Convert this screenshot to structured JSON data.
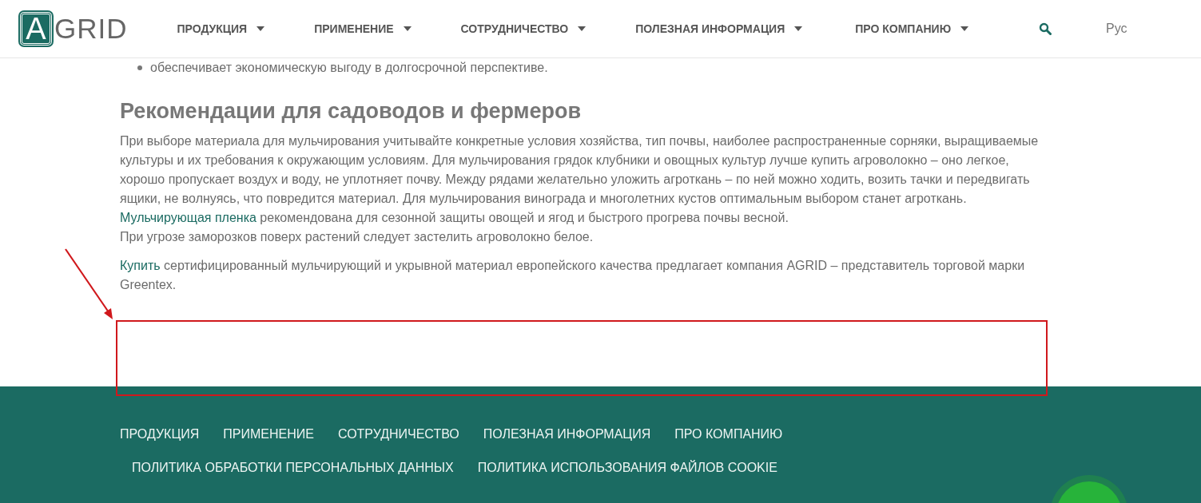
{
  "header": {
    "logo": {
      "letter": "A",
      "text": "GRID"
    },
    "nav": [
      {
        "label": "ПРОДУКЦИЯ",
        "has_dropdown": true
      },
      {
        "label": "ПРИМЕНЕНИЕ",
        "has_dropdown": true
      },
      {
        "label": "СОТРУДНИЧЕСТВО",
        "has_dropdown": true
      },
      {
        "label": "ПОЛЕЗНАЯ ИНФОРМАЦИЯ",
        "has_dropdown": true
      },
      {
        "label": "ПРО КОМПАНИЮ",
        "has_dropdown": true
      }
    ],
    "language": {
      "label": "Рус",
      "selected": true
    }
  },
  "article": {
    "bullets": [
      "обеспечивает экономическую выгоду в долгосрочной перспективе."
    ],
    "heading": "Рекомендации для садоводов и фермеров",
    "paragraphs": [
      {
        "parts": [
          {
            "kind": "text",
            "text": "При выборе материала для мульчирования учитывайте конкретные условия хозяйства, тип почвы, наиболее распространенные сорняки, выращиваемые культуры и их требования к окружающим условиям. Для мульчирования грядок клубники и овощных культур лучше купить агроволокно – оно легкое, хорошо пропускает воздух и воду, не уплотняет почву. Между рядами желательно уложить агроткань – по ней можно ходить, возить тачки и передвигать ящики, не волнуясь, что повредится материал. Для мульчирования винограда и многолетних кустов оптимальным выбором станет агроткань."
          },
          {
            "kind": "link",
            "text": "Мульчирующая пленка"
          },
          {
            "kind": "text",
            "text": "рекомендована для сезонной защиты овощей и ягод и быстрого прогрева почвы весной."
          },
          {
            "kind": "break"
          },
          {
            "kind": "text",
            "text": "При угрозе заморозков поверх растений следует застелить агроволокно белое."
          }
        ]
      },
      {
        "parts": [
          {
            "kind": "link",
            "text": "Купить"
          },
          {
            "kind": "text",
            "text": "сертифицированный мульчирующий и укрывной материал европейского качества предлагает компания AGRID – представитель торговой марки Greentex."
          }
        ]
      }
    ]
  },
  "footer": {
    "menu": [
      "ПРОДУКЦИЯ",
      "ПРИМЕНЕНИЕ",
      "СОТРУДНИЧЕСТВО",
      "ПОЛЕЗНАЯ ИНФОРМАЦИЯ",
      "ПРО КОМПАНИЮ"
    ],
    "legal": [
      "ПОЛИТИКА ОБРАБОТКИ ПЕРСОНАЛЬНЫХ ДАННЫХ",
      "ПОЛИТИКА ИСПОЛЬЗОВАНИЯ ФАЙЛОВ COOKIE"
    ]
  }
}
